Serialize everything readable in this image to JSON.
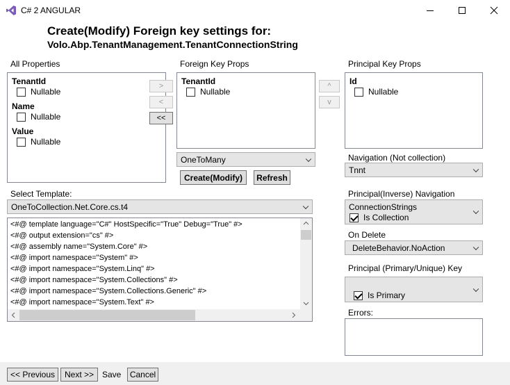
{
  "window": {
    "title": "C# 2 ANGULAR"
  },
  "heading": {
    "line1": "Create(Modify) Foreign key settings for:",
    "line2": "Volo.Abp.TenantManagement.TenantConnectionString"
  },
  "all_properties": {
    "label": "All Properties",
    "items": [
      {
        "name": "TenantId",
        "nullable_label": "Nullable",
        "nullable": false
      },
      {
        "name": "Name",
        "nullable_label": "Nullable",
        "nullable": false
      },
      {
        "name": "Value",
        "nullable_label": "Nullable",
        "nullable": false
      }
    ]
  },
  "move_buttons": {
    "add": ">",
    "remove": "<",
    "remove_all": "<<"
  },
  "foreign_key_props": {
    "label": "Foreign Key Props",
    "items": [
      {
        "name": "TenantId",
        "nullable_label": "Nullable",
        "nullable": false
      }
    ]
  },
  "order_buttons": {
    "up": "^",
    "down": "v"
  },
  "principal_key_props": {
    "label": "Principal Key Props",
    "items": [
      {
        "name": "Id",
        "nullable_label": "Nullable",
        "nullable": false
      }
    ]
  },
  "relationship": {
    "selected": "OneToMany"
  },
  "actions": {
    "create_modify": "Create(Modify)",
    "refresh": "Refresh"
  },
  "template": {
    "label": "Select Template:",
    "selected": "OneToCollection.Net.Core.cs.t4",
    "code_lines": [
      "<#@ template language=\"C#\" HostSpecific=\"True\" Debug=\"True\" #>",
      "<#@ output extension=\"cs\" #>",
      "<#@ assembly name=\"System.Core\" #>",
      "<#@ import namespace=\"System\" #>",
      "<#@ import namespace=\"System.Linq\" #>",
      "<#@ import namespace=\"System.Collections\" #>",
      "<#@ import namespace=\"System.Collections.Generic\" #>",
      "<#@ import namespace=\"System.Text\" #>"
    ]
  },
  "navigation": {
    "label": "Navigation (Not collection)",
    "selected": "Tnnt"
  },
  "inverse_navigation": {
    "label": "Principal(Inverse) Navigation",
    "selected": "ConnectionStrings",
    "is_collection_label": "Is Collection",
    "is_collection": true
  },
  "on_delete": {
    "label": "On Delete",
    "selected": "DeleteBehavior.NoAction"
  },
  "principal_key": {
    "label": "Principal (Primary/Unique) Key",
    "is_primary_label": "Is Primary",
    "is_primary": true
  },
  "errors": {
    "label": "Errors:",
    "value": ""
  },
  "footer": {
    "previous": "<< Previous",
    "next": "Next >>",
    "save": "Save",
    "cancel": "Cancel"
  }
}
